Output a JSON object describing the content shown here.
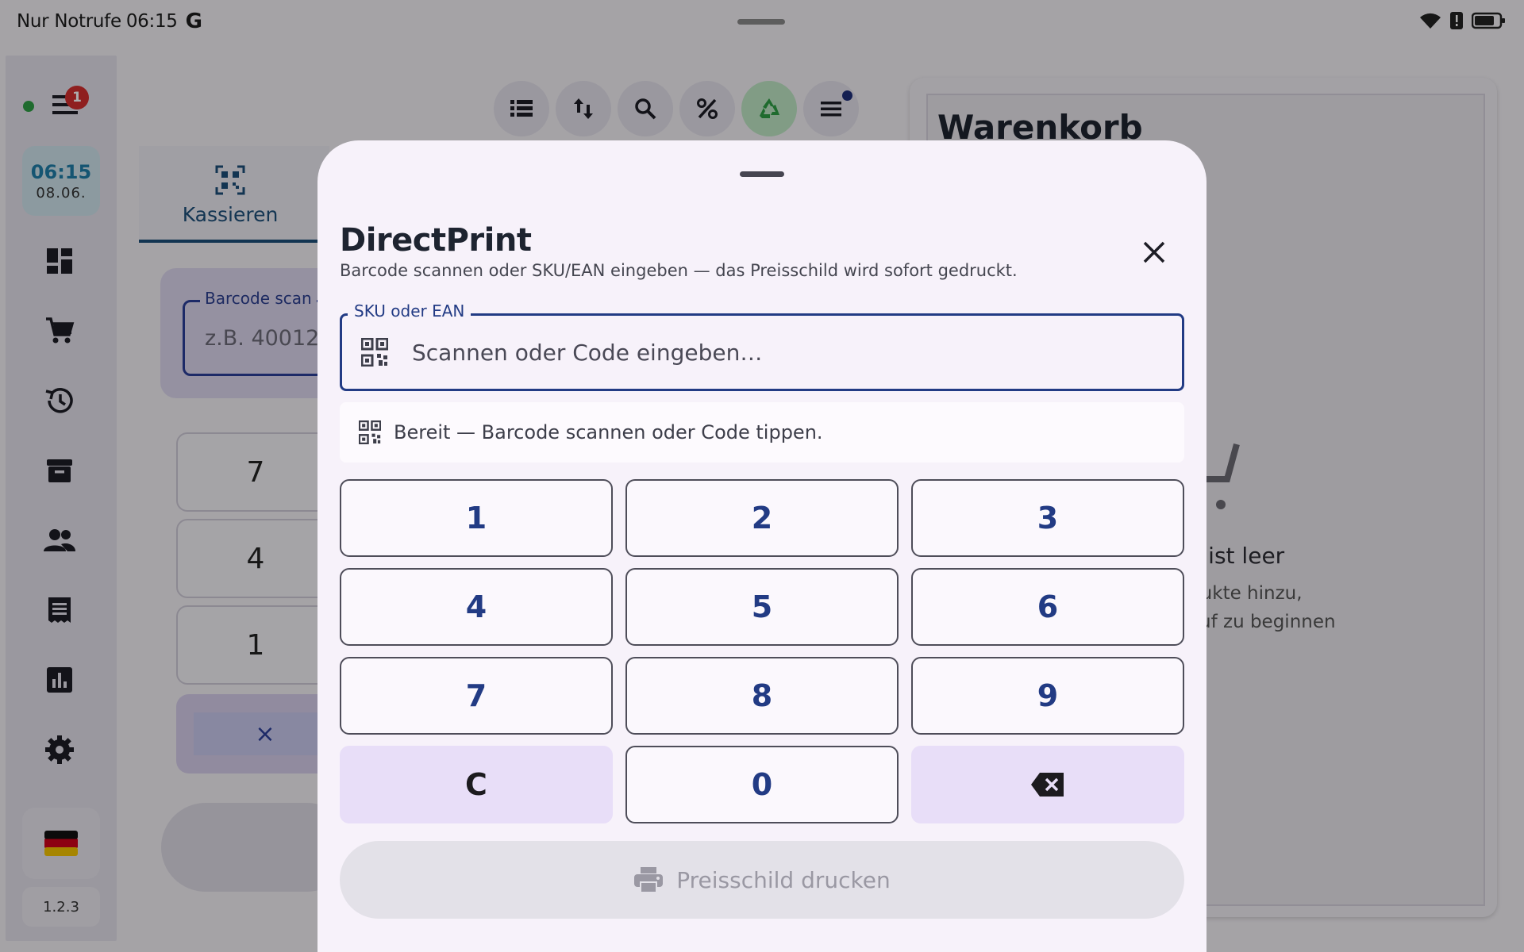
{
  "statusbar": {
    "carrier": "Nur Notrufe",
    "time": "06:15",
    "g": "G"
  },
  "rail": {
    "badge": "1",
    "clock_time": "06:15",
    "clock_date": "08.06.",
    "version": "1.2.3"
  },
  "main": {
    "tab_label": "Kassieren",
    "scan_legend": "Barcode scan",
    "scan_placeholder": "z.B. 40012",
    "keys": [
      "7",
      "4",
      "1"
    ],
    "clear_symbol": "×"
  },
  "cart": {
    "title": "Warenkorb",
    "empty_title": "rb ist leer",
    "empty_sub_1": "odukte hinzu,",
    "empty_sub_2": "kauf zu beginnen"
  },
  "dialog": {
    "title": "DirectPrint",
    "subtitle": "Barcode scannen oder SKU/EAN eingeben — das Preisschild wird sofort gedruckt.",
    "field_label": "SKU oder EAN",
    "field_placeholder": "Scannen oder Code eingeben…",
    "field_value": "",
    "status": "Bereit — Barcode scannen oder Code tippen.",
    "keypad": [
      "1",
      "2",
      "3",
      "4",
      "5",
      "6",
      "7",
      "8",
      "9",
      "C",
      "0"
    ],
    "print_label": "Preisschild drucken"
  },
  "colors": {
    "primary": "#223b84",
    "tonal": "#e8def8",
    "surface": "#f7f2fa",
    "online": "#2e9e44"
  }
}
